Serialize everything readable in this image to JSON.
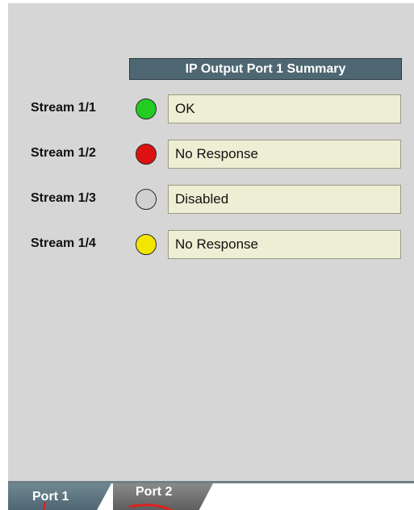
{
  "summary": {
    "title": "IP Output Port 1 Summary"
  },
  "streams": [
    {
      "label": "Stream 1/1",
      "status": "OK",
      "led_color": "#22cc22",
      "led_state": "green"
    },
    {
      "label": "Stream 1/2",
      "status": "No Response",
      "led_color": "#dd1111",
      "led_state": "red"
    },
    {
      "label": "Stream 1/3",
      "status": "Disabled",
      "led_color": "#d0d0d0",
      "led_state": "gray"
    },
    {
      "label": "Stream 1/4",
      "status": "No Response",
      "led_color": "#f2e600",
      "led_state": "yellow"
    }
  ],
  "tabs": [
    {
      "label": "Port 1",
      "selected": true
    },
    {
      "label": "Port 2",
      "selected": false
    }
  ],
  "colors": {
    "panel_bg": "#d6d6d6",
    "header_bg": "#4e6773",
    "field_bg": "#eeeed4",
    "annotation": "#e02020"
  }
}
